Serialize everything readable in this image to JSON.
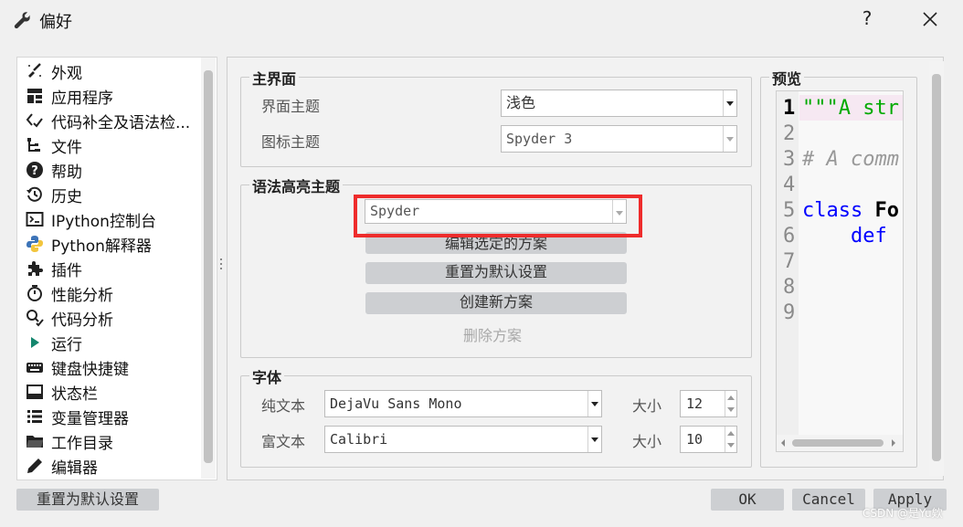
{
  "window": {
    "title": "偏好",
    "help_label": "?"
  },
  "sidebar": {
    "items": [
      {
        "label": "外观",
        "icon": "paint-brush-icon"
      },
      {
        "label": "应用程序",
        "icon": "grid-icon"
      },
      {
        "label": "代码补全及语法检...",
        "icon": "code-check-icon"
      },
      {
        "label": "文件",
        "icon": "file-tree-icon"
      },
      {
        "label": "帮助",
        "icon": "help-icon"
      },
      {
        "label": "历史",
        "icon": "history-icon"
      },
      {
        "label": "IPython控制台",
        "icon": "terminal-icon"
      },
      {
        "label": "Python解释器",
        "icon": "python-icon"
      },
      {
        "label": "插件",
        "icon": "puzzle-icon"
      },
      {
        "label": "性能分析",
        "icon": "stopwatch-icon"
      },
      {
        "label": "代码分析",
        "icon": "code-analysis-icon"
      },
      {
        "label": "运行",
        "icon": "play-icon"
      },
      {
        "label": "键盘快捷键",
        "icon": "keyboard-icon"
      },
      {
        "label": "状态栏",
        "icon": "statusbar-icon"
      },
      {
        "label": "变量管理器",
        "icon": "list-icon"
      },
      {
        "label": "工作目录",
        "icon": "folder-icon"
      },
      {
        "label": "编辑器",
        "icon": "pencil-icon"
      }
    ]
  },
  "main_interface": {
    "title": "主界面",
    "interface_theme_label": "界面主题",
    "interface_theme_value": "浅色",
    "icon_theme_label": "图标主题",
    "icon_theme_value": "Spyder 3"
  },
  "syntax": {
    "title": "语法高亮主题",
    "scheme_value": "Spyder",
    "edit_button": "编辑选定的方案",
    "reset_button": "重置为默认设置",
    "create_button": "创建新方案",
    "delete_button": "删除方案"
  },
  "fonts": {
    "title": "字体",
    "plain_label": "纯文本",
    "plain_font": "DejaVu Sans Mono",
    "plain_size_label": "大小",
    "plain_size": "12",
    "rich_label": "富文本",
    "rich_font": "Calibri",
    "rich_size_label": "大小",
    "rich_size": "10"
  },
  "preview": {
    "title": "预览",
    "line_numbers": [
      "1",
      "2",
      "3",
      "4",
      "5",
      "6",
      "7",
      "8",
      "9"
    ],
    "code": {
      "l1": "\"\"\"A str",
      "l3": "# A comm",
      "l5_kw": "class",
      "l5_name": "Fo",
      "l6_kw": "def"
    },
    "colors": {
      "string": "#00aa00",
      "comment": "#999999",
      "keyword": "#0000ff",
      "current_line_bg": "#f6e8f2"
    }
  },
  "footer": {
    "reset_button": "重置为默认设置",
    "ok_button": "OK",
    "cancel_button": "Cancel",
    "apply_button": "Apply"
  },
  "watermark": "CSDN @是Yu欸",
  "colors": {
    "highlight_box": "#ee2c2c",
    "button_bg": "#cdcfd2"
  }
}
